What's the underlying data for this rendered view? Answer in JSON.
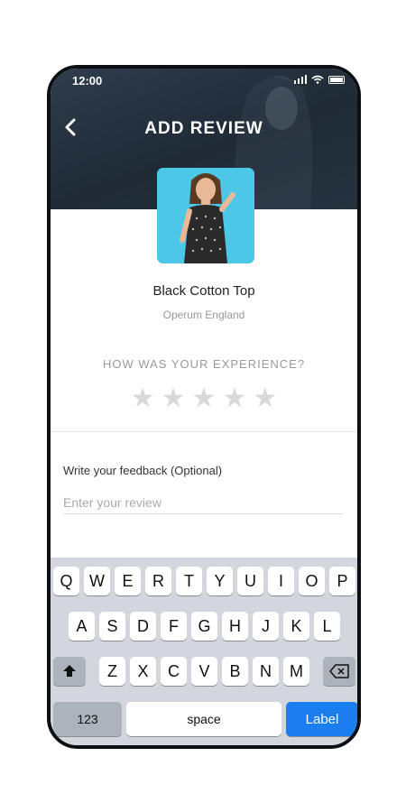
{
  "status_bar": {
    "time": "12:00"
  },
  "header": {
    "title": "ADD REVIEW"
  },
  "product": {
    "name": "Black Cotton Top",
    "brand": "Operum England"
  },
  "rating": {
    "question": "HOW WAS YOUR EXPERIENCE?",
    "stars_total": 5,
    "stars_selected": 0,
    "star_glyph": "★"
  },
  "feedback": {
    "label": "Write your feedback  (Optional)",
    "placeholder": "Enter your review",
    "value": ""
  },
  "keyboard": {
    "row1": [
      "Q",
      "W",
      "E",
      "R",
      "T",
      "Y",
      "U",
      "I",
      "O",
      "P"
    ],
    "row2": [
      "A",
      "S",
      "D",
      "F",
      "G",
      "H",
      "J",
      "K",
      "L"
    ],
    "row3": [
      "Z",
      "X",
      "C",
      "V",
      "B",
      "N",
      "M"
    ],
    "numbers_label": "123",
    "space_label": "space",
    "return_label": "Label",
    "shift_icon": "shift-icon",
    "delete_icon": "backspace-icon"
  },
  "colors": {
    "header_bg": "#26323f",
    "accent_blue": "#1a7df0",
    "product_bg": "#4cc7e8",
    "star_empty": "#d9d9d9"
  }
}
